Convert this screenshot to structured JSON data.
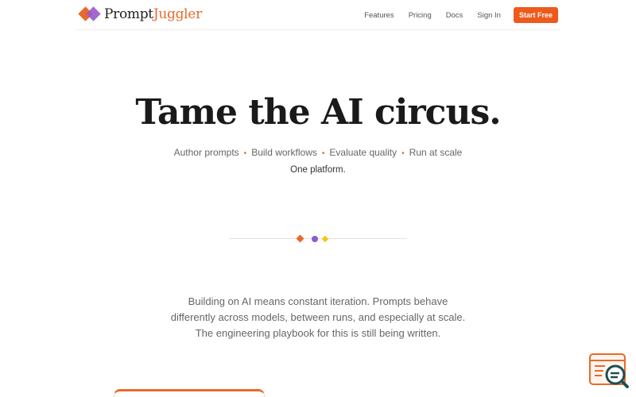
{
  "brand": {
    "name_part1": "Prompt",
    "name_part2": "Juggler",
    "logo_icon": "diamond-logo-icon"
  },
  "nav": {
    "links": [
      "Features",
      "Pricing",
      "Docs",
      "Sign In"
    ],
    "cta_label": "Start Free"
  },
  "hero": {
    "title": "Tame the AI circus.",
    "features": [
      "Author prompts",
      "Build workflows",
      "Evaluate quality",
      "Run at scale"
    ],
    "separator": "•",
    "subtitle": "One platform."
  },
  "body": {
    "line1": "Building on AI means constant iteration. Prompts behave",
    "line2": "differently across models, between runs, and especially at scale.",
    "line3": "The engineering playbook for this is still being written."
  },
  "colors": {
    "accent": "#e8692b",
    "purple": "#8e5bd0",
    "yellow": "#f5c518",
    "cta": "#ee5a1c"
  },
  "icons": {
    "helper": "search-document-icon"
  }
}
